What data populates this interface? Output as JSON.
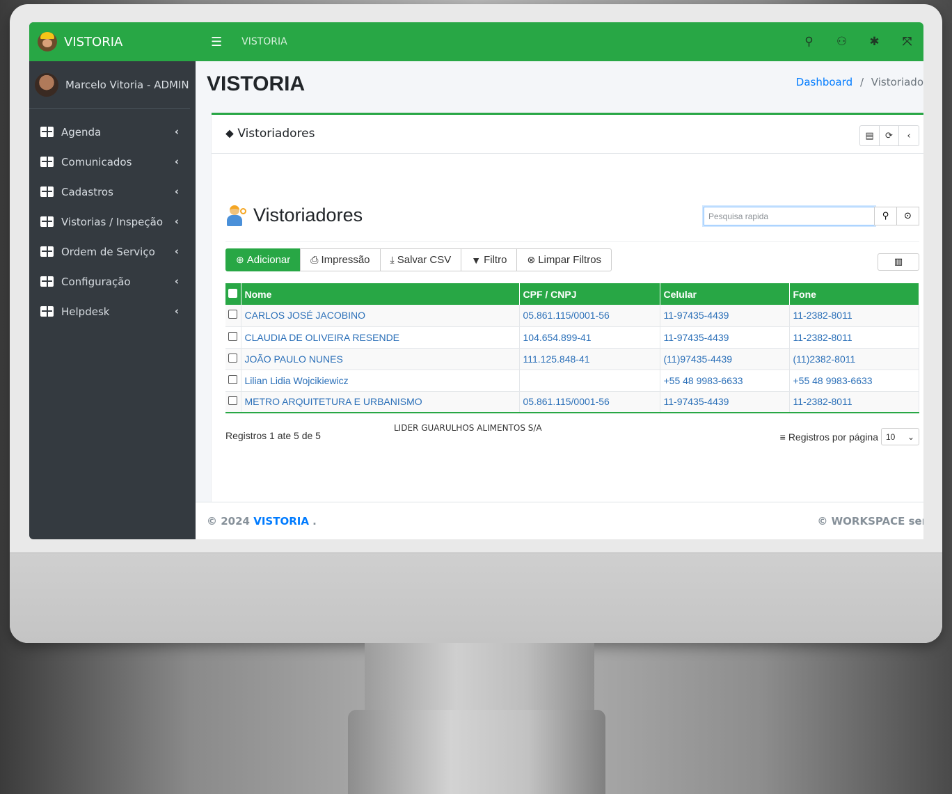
{
  "brand": {
    "name": "VISTORIA"
  },
  "user": {
    "name": "Marcelo Vitoria - ADMIN"
  },
  "sidebar": {
    "items": [
      {
        "label": "Agenda"
      },
      {
        "label": "Comunicados"
      },
      {
        "label": "Cadastros"
      },
      {
        "label": "Vistorias / Inspeção"
      },
      {
        "label": "Ordem de Serviço"
      },
      {
        "label": "Configuração"
      },
      {
        "label": "Helpdesk"
      }
    ]
  },
  "topbar": {
    "title": "VISTORIA",
    "icons": [
      "search-icon",
      "user-icon",
      "gear-icon",
      "expand-icon"
    ]
  },
  "header": {
    "title": "VISTORIA",
    "breadcrumb_link": "Dashboard",
    "breadcrumb_sep": "/",
    "breadcrumb_current": "Vistoriado"
  },
  "card": {
    "title": "Vistoriadores",
    "tools": [
      "file-icon",
      "refresh-icon",
      "collapse-icon"
    ]
  },
  "list": {
    "title": "Vistoriadores",
    "search_placeholder": "Pesquisa rapida",
    "buttons": {
      "add": "Adicionar",
      "print": "Impressão",
      "csv": "Salvar CSV",
      "filter": "Filtro",
      "clear": "Limpar Filtros"
    },
    "columns": [
      "Nome",
      "CPF / CNPJ",
      "Celular",
      "Fone"
    ],
    "rows": [
      {
        "nome": "CARLOS JOSÉ JACOBINO",
        "cpf": "05.861.115/0001-56",
        "celular": "11-97435-4439",
        "fone": "11-2382-8011"
      },
      {
        "nome": "CLAUDIA DE OLIVEIRA RESENDE",
        "cpf": "104.654.899-41",
        "celular": "11-97435-4439",
        "fone": "11-2382-8011"
      },
      {
        "nome": "JOÃO PAULO NUNES",
        "cpf": "111.125.848-41",
        "celular": "(11)97435-4439",
        "fone": "(11)2382-8011"
      },
      {
        "nome": "Lilian Lidia Wojcikiewicz",
        "cpf": "",
        "celular": "+55 48 9983-6633",
        "fone": "+55 48 9983-6633"
      },
      {
        "nome": "METRO ARQUITETURA E URBANISMO",
        "cpf": "05.861.115/0001-56",
        "celular": "11-97435-4439",
        "fone": "11-2382-8011"
      }
    ],
    "records": "Registros 1 ate 5 de 5",
    "company": "LIDER GUARULHOS ALIMENTOS S/A",
    "per_page_label": "Registros por página",
    "per_page_value": "10"
  },
  "footer": {
    "copyright": "© 2024",
    "brand": "VISTORIA",
    "dot": ".",
    "right": "© WORKSPACE servi"
  },
  "colors": {
    "green": "#28a745",
    "sidebar": "#343a40",
    "link": "#007bff"
  }
}
